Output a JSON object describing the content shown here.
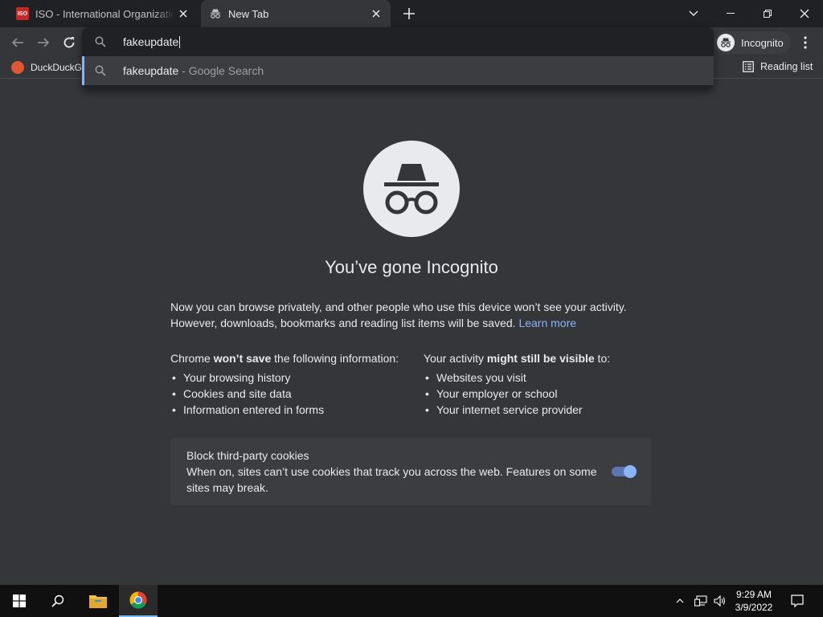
{
  "tabs": [
    {
      "title": "ISO - International Organization for Standardization",
      "favicon": "iso-favicon",
      "favicon_text": "ISO"
    },
    {
      "title": "New Tab",
      "favicon": "incognito-icon",
      "active": true
    }
  ],
  "toolbar": {
    "profile_label": "Incognito"
  },
  "omnibox": {
    "value": "fakeupdate",
    "suggestion": {
      "query": "fakeupdate",
      "source": " - Google Search"
    }
  },
  "bookmarks": {
    "items": [
      {
        "label": "DuckDuckGo"
      }
    ],
    "reading_list": "Reading list"
  },
  "incognito_page": {
    "heading": "You’ve gone Incognito",
    "intro_line1": "Now you can browse privately, and other people who use this device won’t see your activity.",
    "intro_line2": "However, downloads, bookmarks and reading list items will be saved.",
    "learn_more": "Learn more",
    "left_heading_pre": "Chrome ",
    "left_heading_bold": "won’t save",
    "left_heading_post": " the following information:",
    "left_items": [
      "Your browsing history",
      "Cookies and site data",
      "Information entered in forms"
    ],
    "right_heading_pre": "Your activity ",
    "right_heading_bold": "might still be visible",
    "right_heading_post": " to:",
    "right_items": [
      "Websites you visit",
      "Your employer or school",
      "Your internet service provider"
    ],
    "cookie_title": "Block third-party cookies",
    "cookie_desc": "When on, sites can’t use cookies that track you across the web. Features on some sites may break.",
    "cookie_toggle_on": true
  },
  "taskbar": {
    "time": "9:29 AM",
    "date": "3/9/2022"
  },
  "colors": {
    "page_bg": "#35363a",
    "link": "#8ab4f8",
    "tab_strip": "#202124"
  }
}
